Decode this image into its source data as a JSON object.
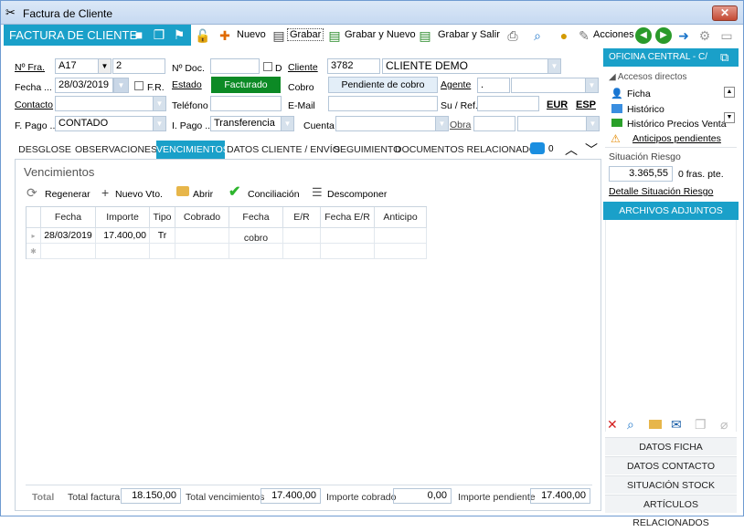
{
  "window": {
    "title": "Factura de Cliente",
    "close": "✕"
  },
  "toolbar": {
    "app_title": "FACTURA DE CLIENTE",
    "nuevo": "Nuevo",
    "grabar": "Grabar",
    "grabar_nuevo": "Grabar y Nuevo",
    "grabar_salir": "Grabar y Salir",
    "acciones": "Acciones"
  },
  "form": {
    "nfra_label": "Nº Fra.",
    "nfra_serie": "A17",
    "nfra_num": "2",
    "ndoc_label": "Nº Doc.",
    "ndoc_value": "",
    "d_label": "D",
    "cliente_label": "Cliente",
    "cliente_code": "3782",
    "cliente_name": "CLIENTE DEMO",
    "fecha_label": "Fecha ...",
    "fecha_value": "28/03/2019",
    "fr_label": "F.R.",
    "estado_label": "Estado",
    "estado_value": "Facturado",
    "cobro_label": "Cobro",
    "cobro_value": "Pendiente de cobro",
    "agente_label": "Agente",
    "agente_value": ".",
    "contacto_label": "Contacto",
    "contacto_value": "",
    "telefono_label": "Teléfono",
    "telefono_value": "",
    "email_label": "E-Mail",
    "email_value": "",
    "suref_label": "Su / Ref.",
    "suref_value": "",
    "eur_label": "EUR",
    "esp_label": "ESP",
    "fpago_label": "F. Pago ..",
    "fpago_value": "CONTADO",
    "ipago_label": "I. Pago ..",
    "ipago_value": "Transferencia",
    "cuenta_label": "Cuenta",
    "cuenta_value": "",
    "obra_label": "Obra",
    "obra_value": ""
  },
  "tabs": [
    {
      "label": "DESGLOSE"
    },
    {
      "label": "OBSERVACIONES"
    },
    {
      "label": "VENCIMIENTOS"
    },
    {
      "label": "DATOS CLIENTE / ENVÍO"
    },
    {
      "label": "SEGUIMIENTO"
    },
    {
      "label": "DOCUMENTOS RELACIONADOS"
    }
  ],
  "comments_count": "0",
  "vencimientos": {
    "title": "Vencimientos",
    "actions": {
      "regenerar": "Regenerar",
      "nuevo": "Nuevo Vto.",
      "abrir": "Abrir",
      "conciliacion": "Conciliación",
      "descomponer": "Descomponer"
    },
    "columns": [
      "Fecha",
      "Importe",
      "Tipo",
      "Cobrado",
      "Fecha cobro",
      "E/R",
      "Fecha E/R",
      "Anticipo"
    ],
    "rows": [
      {
        "fecha": "28/03/2019",
        "importe": "17.400,00",
        "tipo": "Tr",
        "cobrado": "",
        "fecha_cobro": "",
        "er": "",
        "fecha_er": "",
        "anticipo": ""
      }
    ]
  },
  "totals": {
    "total_label": "Total",
    "total_factura_label": "Total factura",
    "total_factura": "18.150,00",
    "total_venc_label": "Total vencimientos",
    "total_venc": "17.400,00",
    "importe_cobrado_label": "Importe cobrado",
    "importe_cobrado": "0,00",
    "importe_pendiente_label": "Importe pendiente",
    "importe_pendiente": "17.400,00"
  },
  "sidebar": {
    "header": "OFICINA CENTRAL - C/",
    "accesos_label": "Accesos directos",
    "accesos": [
      "Ficha",
      "Histórico",
      "Histórico Precios Venta"
    ],
    "anticipos": "Anticipos pendientes",
    "riesgo_label": "Situación Riesgo",
    "riesgo_value": "3.365,55",
    "fras_pte": "0 fras. pte.",
    "detalle_riesgo": "Detalle Situación Riesgo",
    "archivos": "ARCHIVOS ADJUNTOS",
    "buttons": [
      "DATOS FICHA",
      "DATOS CONTACTO",
      "SITUACIÓN STOCK",
      "ARTÍCULOS RELACIONADOS"
    ]
  },
  "colors": {
    "accent": "#1aa0c9",
    "estado_bg": "#0c8a25",
    "warning": "#e48a00"
  }
}
